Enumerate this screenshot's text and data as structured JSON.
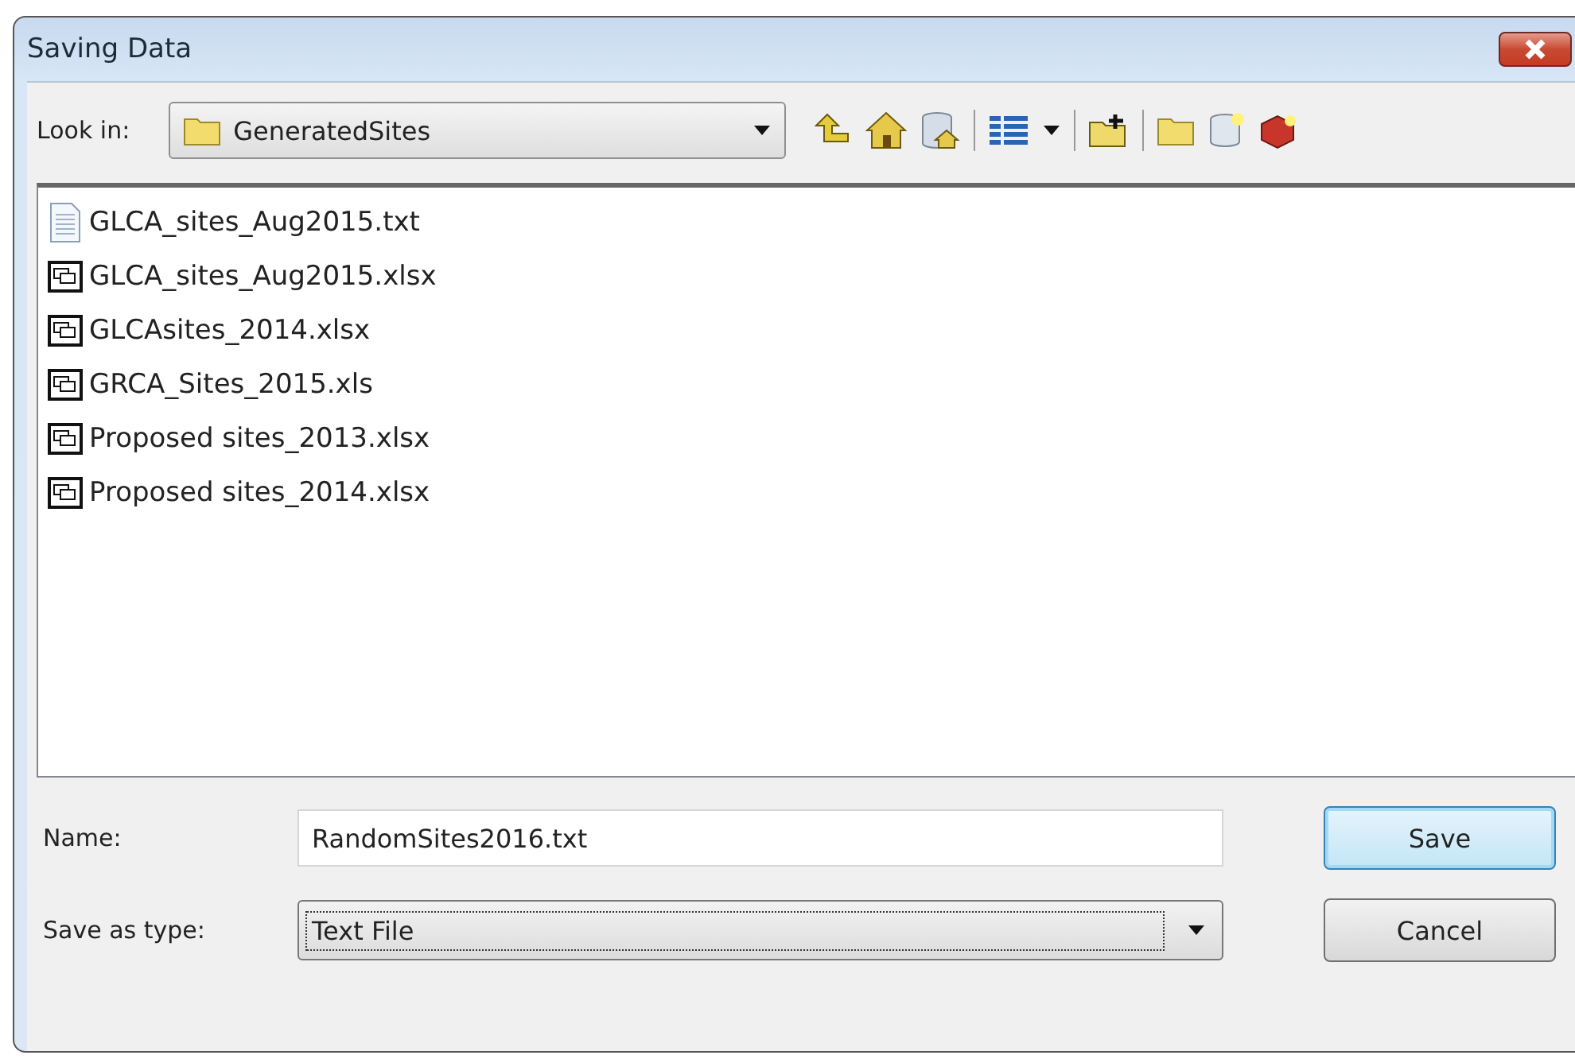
{
  "window": {
    "title": "Saving Data"
  },
  "look_in": {
    "label": "Look in:",
    "value": "GeneratedSites"
  },
  "files": [
    {
      "name": "GLCA_sites_Aug2015.txt",
      "kind": "text"
    },
    {
      "name": "GLCA_sites_Aug2015.xlsx",
      "kind": "table"
    },
    {
      "name": "GLCAsites_2014.xlsx",
      "kind": "table"
    },
    {
      "name": "GRCA_Sites_2015.xls",
      "kind": "table"
    },
    {
      "name": "Proposed sites_2013.xlsx",
      "kind": "table"
    },
    {
      "name": "Proposed sites_2014.xlsx",
      "kind": "table"
    }
  ],
  "name_field": {
    "label": "Name:",
    "value": "RandomSites2016.txt"
  },
  "type_field": {
    "label": "Save as type:",
    "value": "Text File"
  },
  "buttons": [
    {
      "label": "Save",
      "default": true
    },
    {
      "label": "Cancel",
      "default": false
    }
  ]
}
